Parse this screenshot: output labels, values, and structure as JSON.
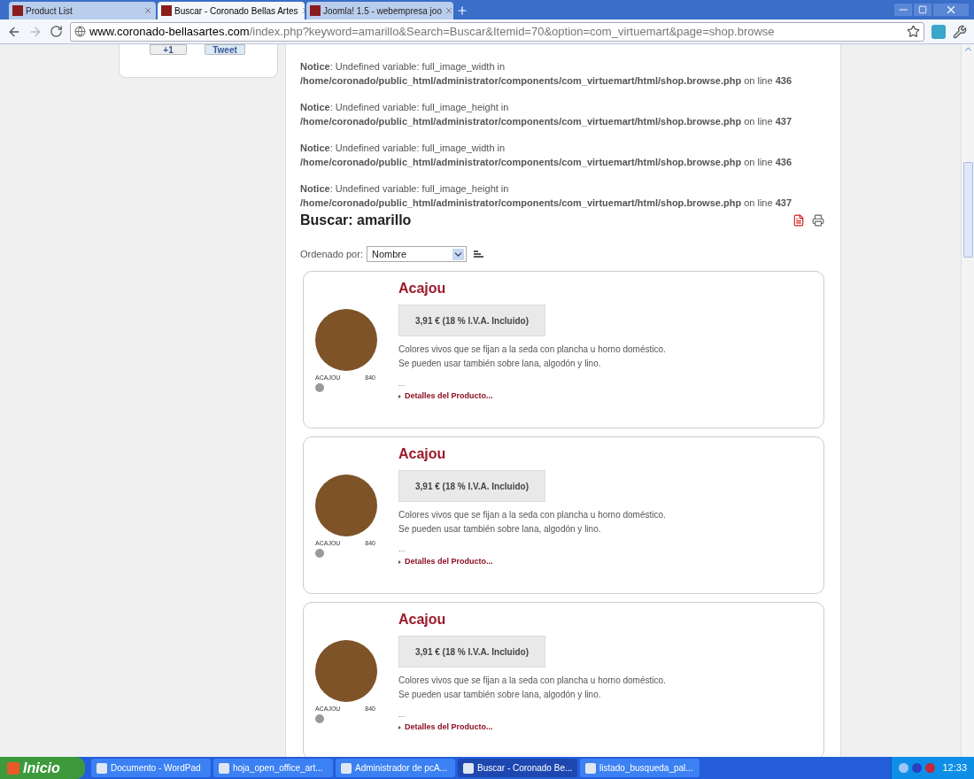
{
  "browser": {
    "tabs": [
      {
        "title": "Product List",
        "selected": false
      },
      {
        "title": "Buscar - Coronado Bellas Artes",
        "selected": true
      },
      {
        "title": "Joomla! 1.5 - webempresa joo",
        "selected": false
      }
    ],
    "url": {
      "domain": "www.coronado-bellasartes.com",
      "path": "/index.php?keyword=amarillo&Search=Buscar&Itemid=70&option=com_virtuemart&page=shop.browse"
    }
  },
  "social_buttons": [
    "+1",
    "Tweet"
  ],
  "notices": [
    "**Notice**: Undefined variable: full_image_width in",
    "**/home/coronado/public_html/administrator/components/com_virtuemart/html/shop.browse.php** on line **436**",
    "**Notice**: Undefined variable: full_image_height in",
    "**/home/coronado/public_html/administrator/components/com_virtuemart/html/shop.browse.php** on line **437**",
    "**Notice**: Undefined variable: full_image_width in",
    "**/home/coronado/public_html/administrator/components/com_virtuemart/html/shop.browse.php** on line **436**",
    "**Notice**: Undefined variable: full_image_height in",
    "**/home/coronado/public_html/administrator/components/com_virtuemart/html/shop.browse.php** on line **437**"
  ],
  "heading": "Buscar: amarillo",
  "sort": {
    "label": "Ordenado por:",
    "value": "Nombre"
  },
  "products": [
    {
      "name": "Acajou",
      "price": "3,91 € (18 % I.V.A. Incluido)",
      "description": [
        "Colores vivos que se fijan a la seda con plancha u horno doméstico.",
        "Se pueden usar también sobre lana, algodón y lino."
      ],
      "more": "...",
      "swatch_label": "ACAJOU",
      "swatch_code": "840",
      "color": "#7d5327",
      "details": "Detalles del Producto..."
    },
    {
      "name": "Acajou",
      "price": "3,91 € (18 % I.V.A. Incluido)",
      "description": [
        "Colores vivos que se fijan a la seda con plancha u horno doméstico.",
        "Se pueden usar también sobre lana, algodón y lino."
      ],
      "more": "...",
      "swatch_label": "ACAJOU",
      "swatch_code": "840",
      "color": "#7d5327",
      "details": "Detalles del Producto..."
    },
    {
      "name": "Acajou",
      "price": "3,91 € (18 % I.V.A. Incluido)",
      "description": [
        "Colores vivos que se fijan a la seda con plancha u horno doméstico.",
        "Se pueden usar también sobre lana, algodón y lino."
      ],
      "more": "...",
      "swatch_label": "ACAJOU",
      "swatch_code": "840",
      "color": "#7d5327",
      "details": "Detalles del Producto..."
    }
  ],
  "taskbar": {
    "start": "Inicio",
    "items": [
      {
        "label": "Documento - WordPad",
        "selected": false
      },
      {
        "label": "hoja_open_office_art...",
        "selected": false
      },
      {
        "label": "Administrador de pcA...",
        "selected": false
      },
      {
        "label": "Buscar - Coronado Be...",
        "selected": true
      },
      {
        "label": "listado_busqueda_pal...",
        "selected": false
      }
    ],
    "clock": "12:33"
  }
}
